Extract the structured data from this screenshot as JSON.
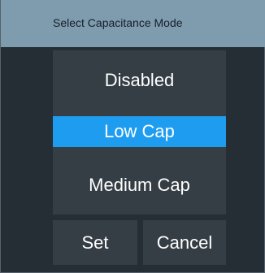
{
  "dialog": {
    "title": "Select Capacitance Mode",
    "options": [
      {
        "label": "Disabled",
        "selected": false
      },
      {
        "label": "Low Cap",
        "selected": true
      },
      {
        "label": "Medium Cap",
        "selected": false
      }
    ],
    "buttons": {
      "set": "Set",
      "cancel": "Cancel"
    }
  },
  "colors": {
    "titlebar": "#7f9bae",
    "background": "#262e35",
    "panel": "#363e45",
    "selection": "#1e9cf0",
    "text": "#ffffff"
  }
}
